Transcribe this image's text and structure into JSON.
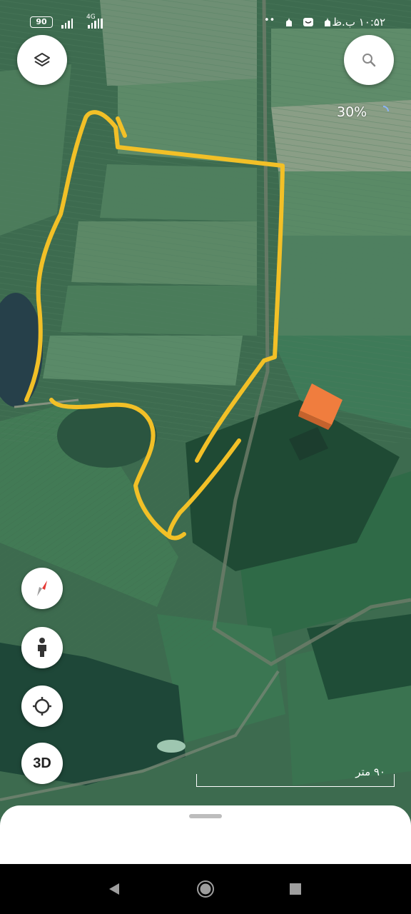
{
  "status_bar": {
    "battery": "90",
    "network_type": "4G",
    "time": "۱۰:۵۲ ب.ظ",
    "dots": "••"
  },
  "map": {
    "type": "satellite",
    "zoom_percent": "30%",
    "scale_label": "۹۰ متر",
    "overlay_color": "#f2c027",
    "roof_color": "#f07d3e"
  },
  "buttons": {
    "layers_icon": "layers-icon",
    "search_icon": "search-icon",
    "compass_icon": "compass-icon",
    "streetview_icon": "person-icon",
    "locate_icon": "crosshair-icon",
    "three_d_label": "3D"
  },
  "nav_bar": {
    "back_icon": "back-icon",
    "home_icon": "home-icon",
    "recents_icon": "recents-icon"
  }
}
